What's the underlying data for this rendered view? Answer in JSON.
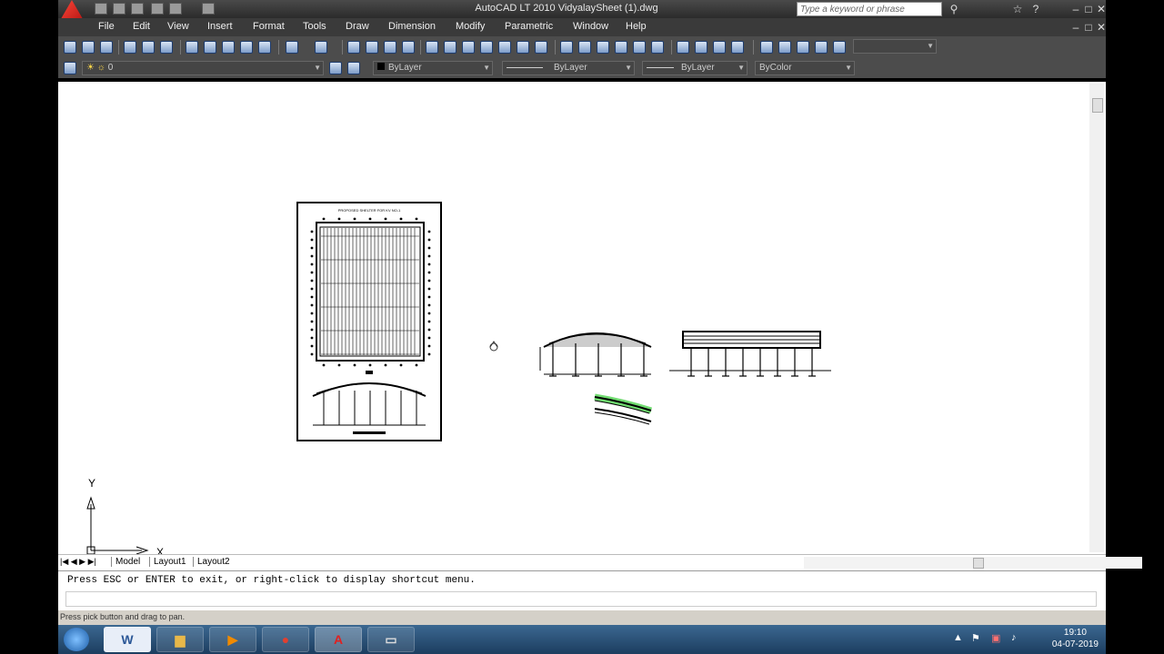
{
  "title": "AutoCAD LT 2010     VidyalaySheet (1).dwg",
  "search": {
    "placeholder": "Type a keyword or phrase"
  },
  "menu": [
    "File",
    "Edit",
    "View",
    "Insert",
    "Format",
    "Tools",
    "Draw",
    "Dimension",
    "Modify",
    "Parametric",
    "Window",
    "Help"
  ],
  "layer": {
    "name": "0",
    "color": "ByLayer",
    "linetype": "ByLayer",
    "lineweight": "ByLayer",
    "plotstyle": "ByColor"
  },
  "drawing": {
    "sheet_title": "PROPOSED SHELTER FOR KV NO-1"
  },
  "ucs": {
    "y_label": "Y",
    "x_label": "X"
  },
  "tabs": {
    "model": "Model",
    "layout1": "Layout1",
    "layout2": "Layout2"
  },
  "command": {
    "prompt": "Press ESC or ENTER to exit, or right-click to display shortcut menu."
  },
  "status": {
    "text": "Press pick button and drag to pan."
  },
  "taskbar": {
    "time": "19:10",
    "date": "04-07-2019"
  },
  "colors": {
    "highlight": "#4cd24c",
    "accent": "#c81e1e"
  }
}
